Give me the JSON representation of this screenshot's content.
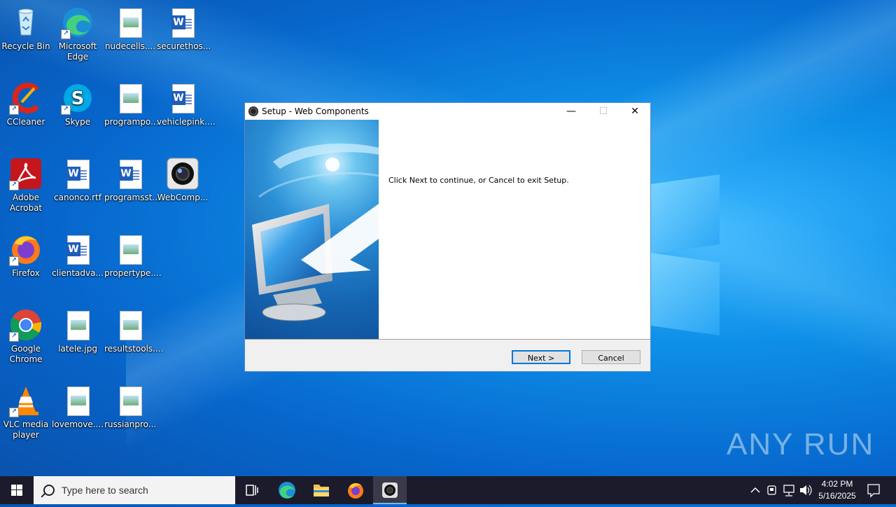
{
  "desktop": {
    "icons": [
      {
        "label": "Recycle Bin"
      },
      {
        "label": "Microsoft Edge"
      },
      {
        "label": "nudecells...."
      },
      {
        "label": "securethos..."
      },
      {
        "label": "CCleaner"
      },
      {
        "label": "Skype"
      },
      {
        "label": "programpo..."
      },
      {
        "label": "vehiclepink...."
      },
      {
        "label": "Adobe Acrobat"
      },
      {
        "label": "canonco.rtf"
      },
      {
        "label": "programsst..."
      },
      {
        "label": "WebComp..."
      },
      {
        "label": "Firefox"
      },
      {
        "label": "clientadva..."
      },
      {
        "label": "propertype...."
      },
      {
        "label": "Google Chrome"
      },
      {
        "label": "latele.jpg"
      },
      {
        "label": "resultstools...."
      },
      {
        "label": "VLC media player"
      },
      {
        "label": "lovemove...."
      },
      {
        "label": "russianpro..."
      }
    ]
  },
  "dialog": {
    "title": "Setup - Web Components",
    "message": "Click Next to continue, or Cancel to exit Setup.",
    "next_label": "Next >",
    "cancel_label": "Cancel",
    "minimize_glyph": "—",
    "maximize_glyph": "☐",
    "close_glyph": "✕"
  },
  "watermark": "ANY RUN",
  "taskbar": {
    "search_placeholder": "Type here to search",
    "time": "4:02 PM",
    "date": "5/16/2025"
  }
}
